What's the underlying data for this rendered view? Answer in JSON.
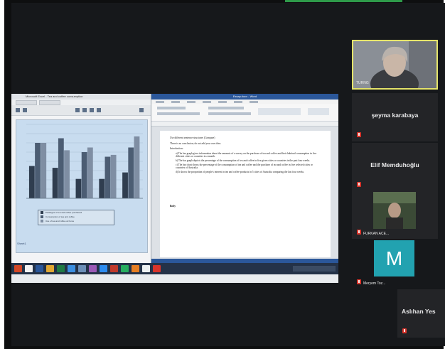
{
  "share": {
    "excel_title": "Microsoft Excel - Tea and coffee consumption",
    "sheet_link": "Sheet1",
    "legend": [
      {
        "label": "Packages of tea and coffee purchased",
        "color": "#2f3d4f"
      },
      {
        "label": "Consumption of tea and coffee",
        "color": "#4c5d73"
      },
      {
        "label": "Use of tea and coffee at home",
        "color": "#7f8ea3"
      }
    ],
    "word_title": "Essay.docx - Word",
    "doc_lines": [
      "Use different sentence structures (Compare)",
      "There is no conclusion; do not add your own idea.",
      "Introduction:"
    ],
    "doc_items": [
      "a) The bar graph gives information about the amounts of a survey on the purchase of tea and coffee and their habitual consumption in five different cities or countries in a month.",
      "b) The bar graph depicts the percentage of the consumption of tea and coffee in five given cities or countries in the past four weeks.",
      "c) The bar chart shows the percentage of the consumption of tea and coffee and the purchase of tea and coffee in five selected cities or countries of Australia.",
      "d) It shows the proportion of people's interest in tea and coffee products in 5 cities of Australia comparing the last four weeks."
    ],
    "doc_footer": "Body"
  },
  "chart_data": {
    "type": "bar",
    "categories": [
      "",
      "",
      "",
      "",
      ""
    ],
    "series": [
      {
        "name": "Packages of tea and coffee purchased",
        "values": [
          35,
          33,
          21,
          21,
          28
        ]
      },
      {
        "name": "Consumption of tea and coffee",
        "values": [
          60,
          65,
          50,
          45,
          55
        ]
      },
      {
        "name": "Use of tea and coffee at home",
        "values": [
          60,
          52,
          55,
          47,
          67
        ]
      }
    ],
    "ylim": [
      0,
      80
    ]
  },
  "participants": {
    "speaker_label": "TURNG",
    "tiles": [
      {
        "name": "şeyma karabaya",
        "kind": "text"
      },
      {
        "name": "Elif Memduhoğlu",
        "kind": "text"
      },
      {
        "name": "FURKAN ACE...",
        "kind": "video"
      },
      {
        "name": "Meryem Toz...",
        "kind": "avatar",
        "initial": "M"
      },
      {
        "name": "Aslıhan Yes",
        "kind": "text"
      }
    ]
  }
}
